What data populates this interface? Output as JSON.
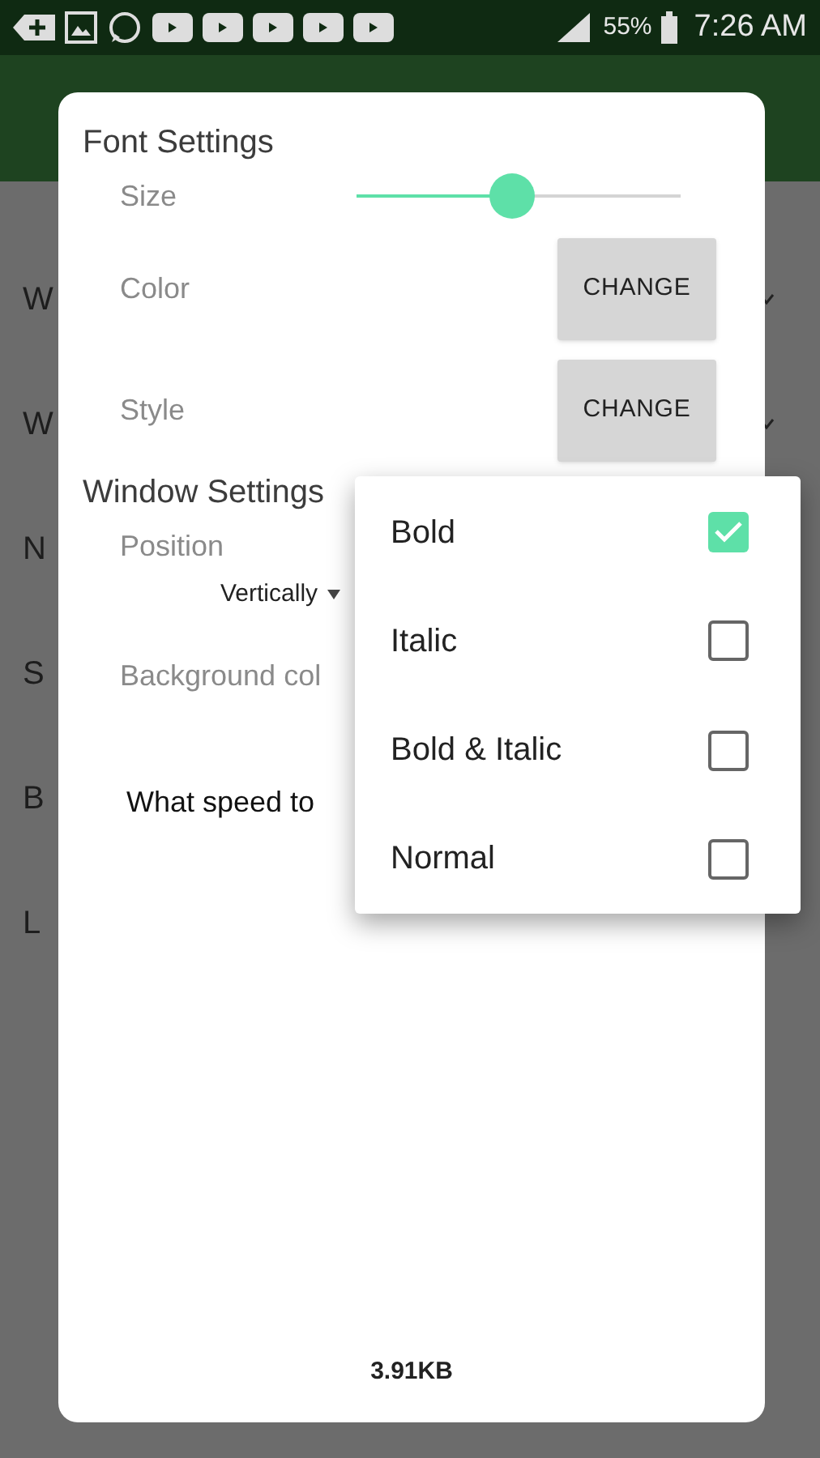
{
  "status_bar": {
    "battery": "55%",
    "time": "7:26 AM"
  },
  "background_items": [
    {
      "label": "W",
      "chevron": true
    },
    {
      "label": "W",
      "chevron": true
    },
    {
      "label": "N"
    },
    {
      "label": "S"
    },
    {
      "label": "B"
    },
    {
      "label": "L"
    }
  ],
  "dialog": {
    "sections": [
      {
        "title": "Font Settings",
        "rows": [
          {
            "kind": "slider",
            "label": "Size",
            "level": 0.48
          },
          {
            "kind": "button",
            "label": "Color",
            "button": "CHANGE"
          },
          {
            "kind": "button",
            "label": "Style",
            "button": "CHANGE"
          }
        ]
      },
      {
        "title": "Window Settings",
        "rows": [
          {
            "kind": "label",
            "label": "Position"
          },
          {
            "kind": "dropdown",
            "value": "Vertically"
          },
          {
            "kind": "label",
            "label": "Background col"
          },
          {
            "kind": "question",
            "label": "What speed to"
          }
        ]
      }
    ],
    "footer": "3.91KB"
  },
  "style_menu": [
    {
      "label": "Bold",
      "checked": true
    },
    {
      "label": "Italic",
      "checked": false
    },
    {
      "label": "Bold & Italic",
      "checked": false
    },
    {
      "label": "Normal",
      "checked": false
    }
  ]
}
